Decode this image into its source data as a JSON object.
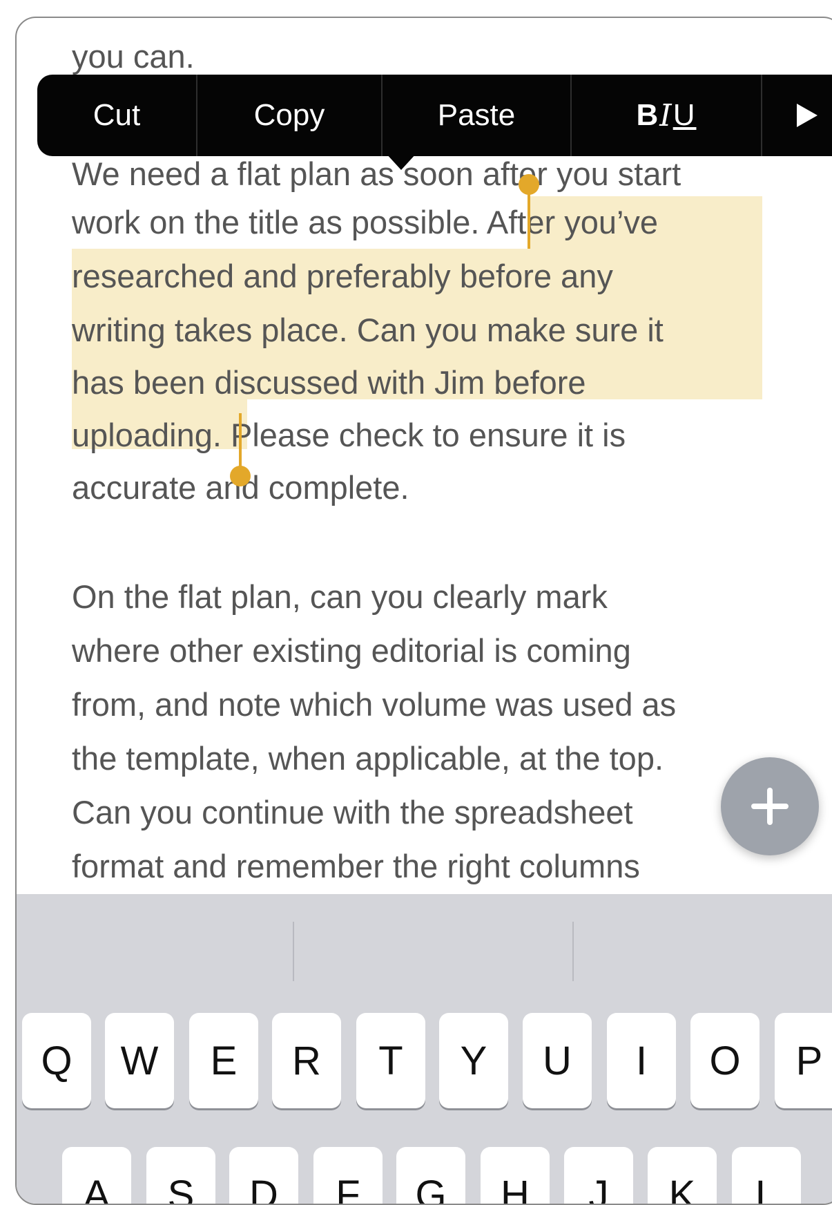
{
  "document": {
    "lines": [
      "you can.",
      "We need a flat plan as soon after you start",
      "work on the title as possible. After you’ve",
      "researched and preferably before any",
      "writing takes place. Can you make sure it",
      "has been discussed with Jim before",
      "uploading. Please check to ensure it is",
      "accurate and complete.",
      "On the flat plan, can you clearly mark",
      "where other existing editorial is coming",
      "from, and note which volume was used as",
      "the template, when applicable, at the top.",
      "Can you continue with the spreadsheet",
      "format and remember the right columns"
    ]
  },
  "edit_menu": {
    "cut": "Cut",
    "copy": "Copy",
    "paste": "Paste",
    "bold": "B",
    "italic": "I",
    "underline": "U",
    "more_icon": "play-triangle"
  },
  "fab": {
    "icon": "plus-icon"
  },
  "keyboard": {
    "row1": [
      "Q",
      "W",
      "E",
      "R",
      "T",
      "Y",
      "U",
      "I",
      "O",
      "P"
    ],
    "row2": [
      "A",
      "S",
      "D",
      "F",
      "G",
      "H",
      "J",
      "K",
      "L"
    ]
  },
  "colors": {
    "selection_highlight": "#f8edc9",
    "selection_handle": "#e3a82a",
    "menu_background": "#050505",
    "keyboard_background": "#d4d5da"
  }
}
